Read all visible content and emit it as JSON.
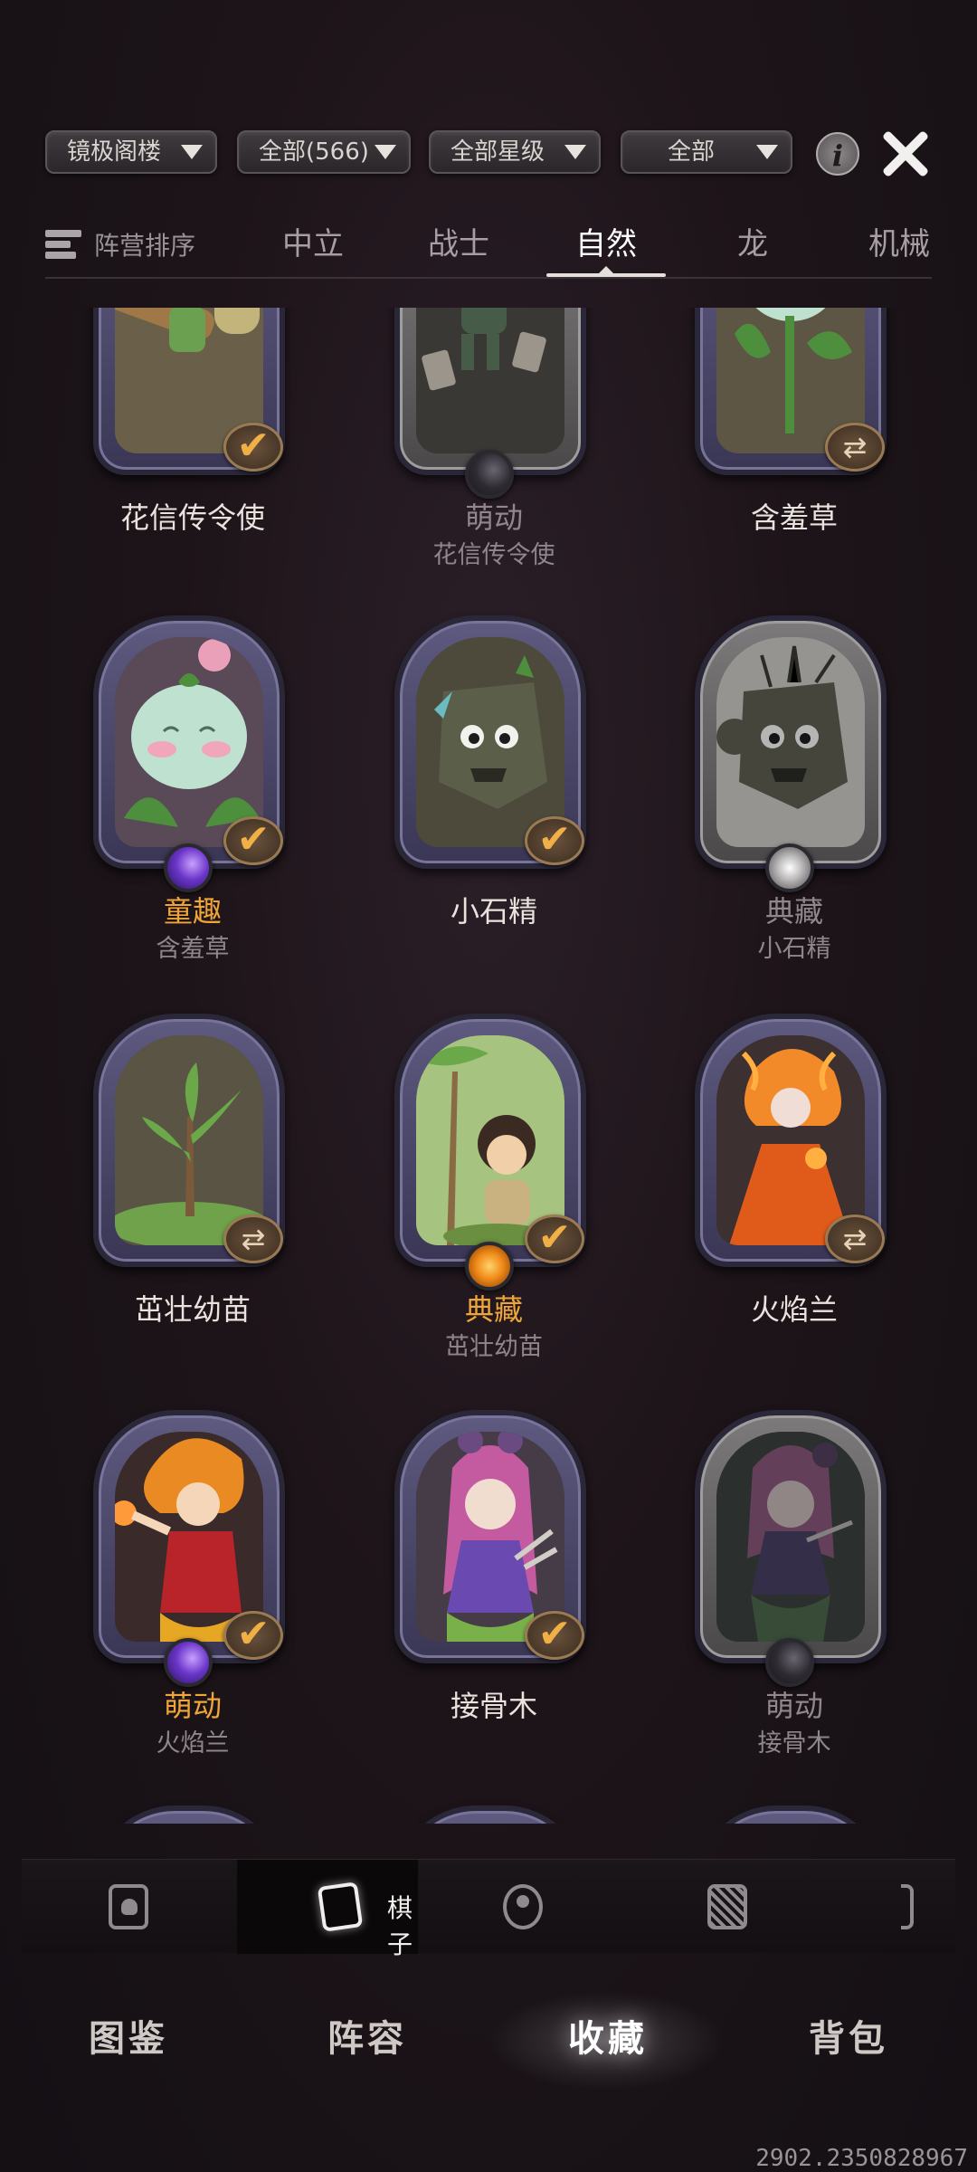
{
  "filters": [
    {
      "label": "镜极阁楼"
    },
    {
      "label": "全部(566)"
    },
    {
      "label": "全部星级"
    },
    {
      "label": "全部"
    }
  ],
  "info_label": "i",
  "sort_label": "阵营排序",
  "factions": [
    {
      "label": "中立",
      "active": false
    },
    {
      "label": "战士",
      "active": false
    },
    {
      "label": "自然",
      "active": true
    },
    {
      "label": "龙",
      "active": false
    },
    {
      "label": "机械",
      "active": false
    }
  ],
  "cards": [
    {
      "name": "花信传令使",
      "subtitle": "",
      "name_style": "normal",
      "badge": "check",
      "gem": "",
      "frame": "purple",
      "art": "fairy"
    },
    {
      "name": "萌动",
      "subtitle": "花信传令使",
      "name_style": "dim",
      "badge": "",
      "gem": "dark",
      "frame": "grey",
      "art": "fairy-dim"
    },
    {
      "name": "含羞草",
      "subtitle": "",
      "name_style": "normal",
      "badge": "swap",
      "gem": "",
      "frame": "purple",
      "art": "bulb"
    },
    {
      "name": "童趣",
      "subtitle": "含羞草",
      "name_style": "gold",
      "badge": "check",
      "gem": "purple",
      "frame": "purple",
      "art": "bulb-pink"
    },
    {
      "name": "小石精",
      "subtitle": "",
      "name_style": "normal",
      "badge": "check",
      "gem": "",
      "frame": "purple",
      "art": "rock"
    },
    {
      "name": "典藏",
      "subtitle": "小石精",
      "name_style": "dim",
      "badge": "",
      "gem": "silver",
      "frame": "grey",
      "art": "rock-light"
    },
    {
      "name": "茁壮幼苗",
      "subtitle": "",
      "name_style": "normal",
      "badge": "swap",
      "gem": "",
      "frame": "purple",
      "art": "sapling"
    },
    {
      "name": "典藏",
      "subtitle": "茁壮幼苗",
      "name_style": "gold",
      "badge": "check",
      "gem": "orange",
      "frame": "purple",
      "art": "girl-tree"
    },
    {
      "name": "火焰兰",
      "subtitle": "",
      "name_style": "normal",
      "badge": "swap",
      "gem": "",
      "frame": "purple",
      "art": "flame"
    },
    {
      "name": "萌动",
      "subtitle": "火焰兰",
      "name_style": "gold",
      "badge": "check",
      "gem": "purple",
      "frame": "purple",
      "art": "flame-red"
    },
    {
      "name": "接骨木",
      "subtitle": "",
      "name_style": "normal",
      "badge": "check",
      "gem": "",
      "frame": "purple",
      "art": "elder"
    },
    {
      "name": "萌动",
      "subtitle": "接骨木",
      "name_style": "dim",
      "badge": "",
      "gem": "dark",
      "frame": "grey",
      "art": "elder-dim"
    }
  ],
  "subtabs": [
    {
      "icon": "card-ghost-icon",
      "label": "",
      "active": false
    },
    {
      "icon": "cards-icon",
      "label": "棋子",
      "active": true
    },
    {
      "icon": "avatar-frame-icon",
      "label": "",
      "active": false
    },
    {
      "icon": "card-back-icon",
      "label": "",
      "active": false
    },
    {
      "icon": "partial-icon",
      "label": "",
      "active": false
    }
  ],
  "nav": [
    {
      "label": "图鉴",
      "active": false
    },
    {
      "label": "阵容",
      "active": false
    },
    {
      "label": "收藏",
      "active": true
    },
    {
      "label": "背包",
      "active": false
    }
  ],
  "version": "2902.2350828967",
  "colors": {
    "gold": "#f0a538",
    "accent": "#ffffff",
    "dim_text": "#8e868b"
  }
}
